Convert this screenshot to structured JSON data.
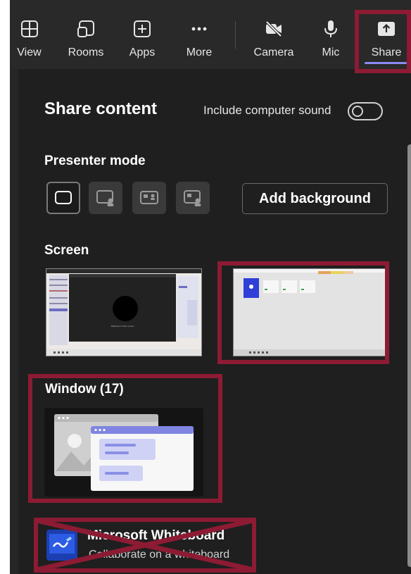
{
  "toolbar": {
    "items": [
      {
        "label": "View",
        "icon": "view-grid-icon"
      },
      {
        "label": "Rooms",
        "icon": "rooms-icon"
      },
      {
        "label": "Apps",
        "icon": "apps-add-icon"
      },
      {
        "label": "More",
        "icon": "more-dots-icon"
      },
      {
        "label": "Camera",
        "icon": "camera-off-icon"
      },
      {
        "label": "Mic",
        "icon": "microphone-icon"
      },
      {
        "label": "Share",
        "icon": "share-upload-icon"
      }
    ],
    "active": "Share"
  },
  "share_panel": {
    "title": "Share content",
    "include_sound_label": "Include computer sound",
    "include_sound_on": false,
    "presenter_mode": {
      "heading": "Presenter mode",
      "modes": [
        "content-only-icon",
        "standout-icon",
        "side-by-side-icon",
        "reporter-icon"
      ],
      "selected_index": 0,
      "add_background_label": "Add background"
    },
    "screen": {
      "heading": "Screen",
      "screens": [
        "screen-1",
        "screen-2"
      ],
      "thumbnail_caption": "Waiting for others to join..."
    },
    "window": {
      "heading": "Window (17)"
    },
    "whiteboard": {
      "title": "Microsoft Whiteboard",
      "subtitle": "Collaborate on a whiteboard",
      "icon": "whiteboard-icon"
    }
  },
  "colors": {
    "highlight": "#8c1b33",
    "accent": "#8b8cf0",
    "background": "#1f1f1f",
    "toolbar": "#292929"
  }
}
